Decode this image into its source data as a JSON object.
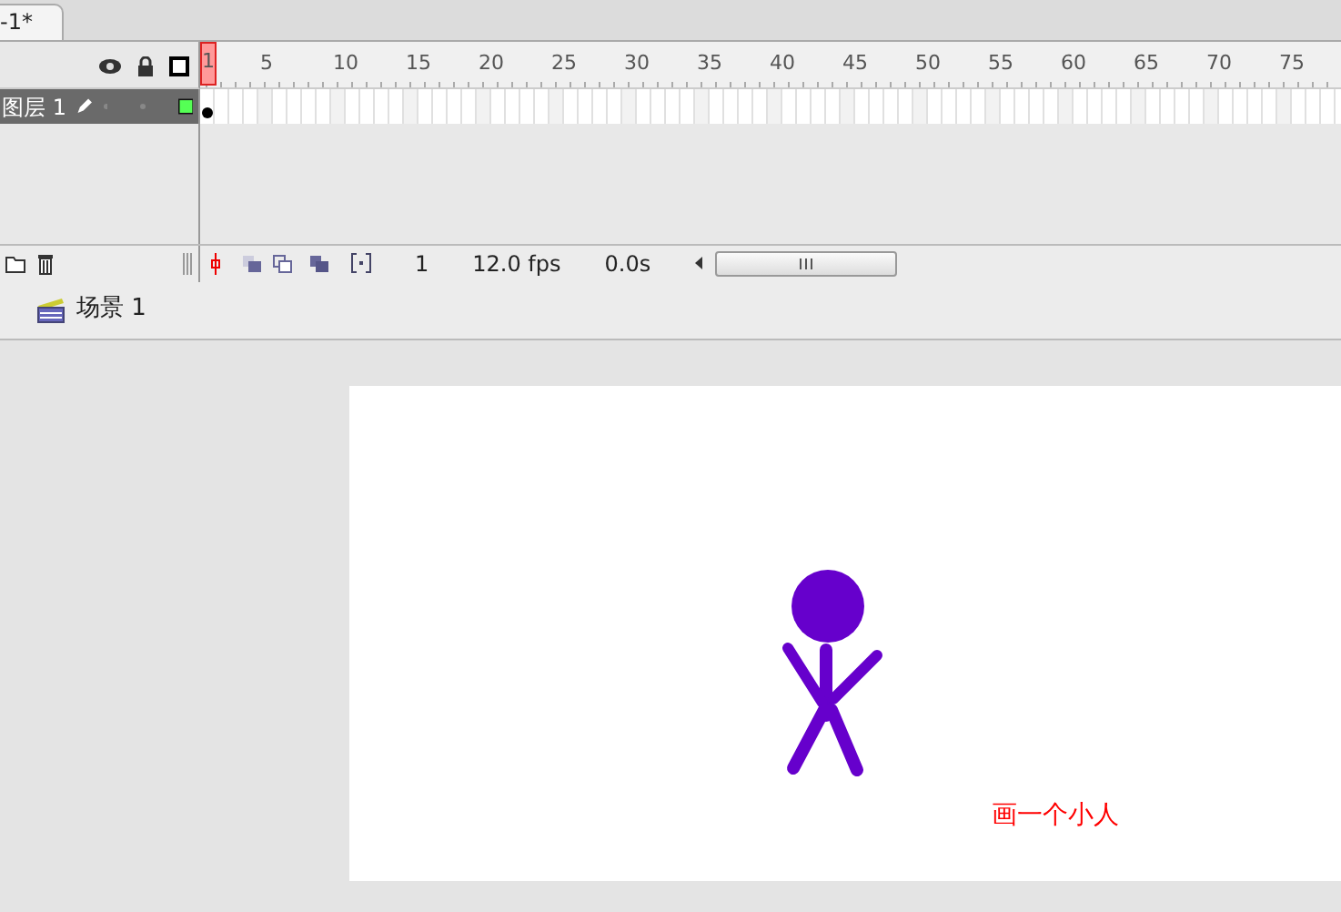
{
  "document_tab": {
    "title": "-1*",
    "selected": true
  },
  "timeline": {
    "frame_numbers": [
      "1",
      "5",
      "10",
      "15",
      "20",
      "25",
      "30",
      "35",
      "40",
      "45",
      "50",
      "55",
      "60",
      "65",
      "70",
      "75"
    ],
    "layers": [
      {
        "name": "图层 1",
        "selected": true
      }
    ],
    "status": {
      "current_frame": "1",
      "frame_rate": "12.0 fps",
      "elapsed_time": "0.0s"
    }
  },
  "breadcrumb": {
    "scene": "场景 1"
  },
  "stage": {
    "caption": "画一个小人"
  }
}
